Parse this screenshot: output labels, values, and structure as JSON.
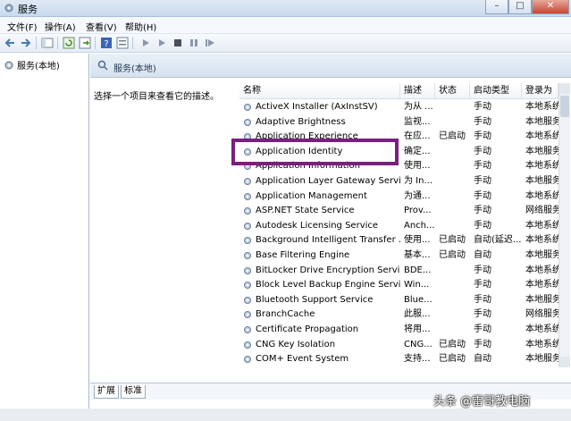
{
  "window": {
    "title": "服务"
  },
  "menu": [
    "文件(F)",
    "操作(A)",
    "查看(V)",
    "帮助(H)"
  ],
  "tree": {
    "root": "服务(本地)"
  },
  "pane": {
    "title": "服务(本地)",
    "description_prompt": "选择一个项目来查看它的描述。",
    "tabs": [
      "扩展",
      "标准"
    ]
  },
  "columns": [
    "名称",
    "描述",
    "状态",
    "启动类型",
    "登录为"
  ],
  "services": [
    [
      "ActiveX Installer (AxInstSV)",
      "为从 ...",
      "",
      "手动",
      "本地系统"
    ],
    [
      "Adaptive Brightness",
      "监视...",
      "",
      "手动",
      "本地服务"
    ],
    [
      "Application Experience",
      "在应...",
      "已启动",
      "手动",
      "本地系统"
    ],
    [
      "Application Identity",
      "确定...",
      "",
      "手动",
      "本地服务"
    ],
    [
      "Application Information",
      "使用...",
      "",
      "手动",
      "本地系统"
    ],
    [
      "Application Layer Gateway Service",
      "为 In...",
      "",
      "手动",
      "本地服务"
    ],
    [
      "Application Management",
      "为通...",
      "",
      "手动",
      "本地系统"
    ],
    [
      "ASP.NET State Service",
      "Prov...",
      "",
      "手动",
      "网络服务"
    ],
    [
      "Autodesk Licensing Service",
      "Anch...",
      "",
      "手动",
      "本地系统"
    ],
    [
      "Background Intelligent Transfer ...",
      "使用...",
      "已启动",
      "自动(延迟...",
      "本地系统"
    ],
    [
      "Base Filtering Engine",
      "基本...",
      "已启动",
      "自动",
      "本地服务"
    ],
    [
      "BitLocker Drive Encryption Service",
      "BDE...",
      "",
      "手动",
      "本地系统"
    ],
    [
      "Block Level Backup Engine Service",
      "Win...",
      "",
      "手动",
      "本地系统"
    ],
    [
      "Bluetooth Support Service",
      "Blue...",
      "",
      "手动",
      "本地服务"
    ],
    [
      "BranchCache",
      "此服...",
      "",
      "手动",
      "网络服务"
    ],
    [
      "Certificate Propagation",
      "将用...",
      "",
      "手动",
      "本地系统"
    ],
    [
      "CNG Key Isolation",
      "CNG...",
      "已启动",
      "手动",
      "本地系统"
    ],
    [
      "COM+ Event System",
      "支持...",
      "已启动",
      "自动",
      "本地服务"
    ]
  ],
  "watermark": "头条 @雷哥教电脑",
  "colors": {
    "highlight": "#7a1f7f",
    "header": "#d6e2ef"
  }
}
